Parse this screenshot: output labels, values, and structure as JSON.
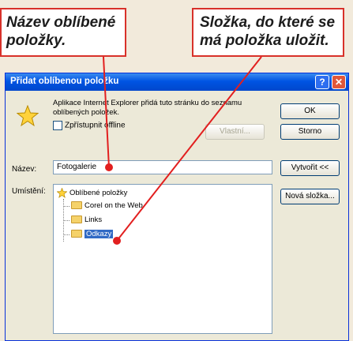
{
  "callouts": {
    "name_field": "Název oblíbené položky.",
    "folder": "Složka, do které se má položka uložit."
  },
  "dialog": {
    "title": "Přidat oblíbenou položku",
    "help_glyph": "?",
    "close_glyph": "✕",
    "info_text": "Aplikace Internet Explorer přidá tuto stránku do seznamu oblíbených položek.",
    "offline_checkbox": {
      "label": "Zpřístupnit offline",
      "checked": false
    },
    "buttons": {
      "ok": "OK",
      "cancel": "Storno",
      "properties": "Vlastní...",
      "create_in": "Vytvořit <<",
      "new_folder": "Nová složka..."
    },
    "name_label": "Název:",
    "name_value": "Fotogalerie",
    "location_label": "Umístění:",
    "tree": {
      "root": "Oblíbené položky",
      "children": [
        "Corel on the Web",
        "Links",
        "Odkazy"
      ],
      "selected": "Odkazy"
    }
  },
  "colors": {
    "callout_border": "#d8312a",
    "leader_line": "#e21f1f",
    "titlebar": "#0054e3",
    "selection": "#316ac5"
  }
}
